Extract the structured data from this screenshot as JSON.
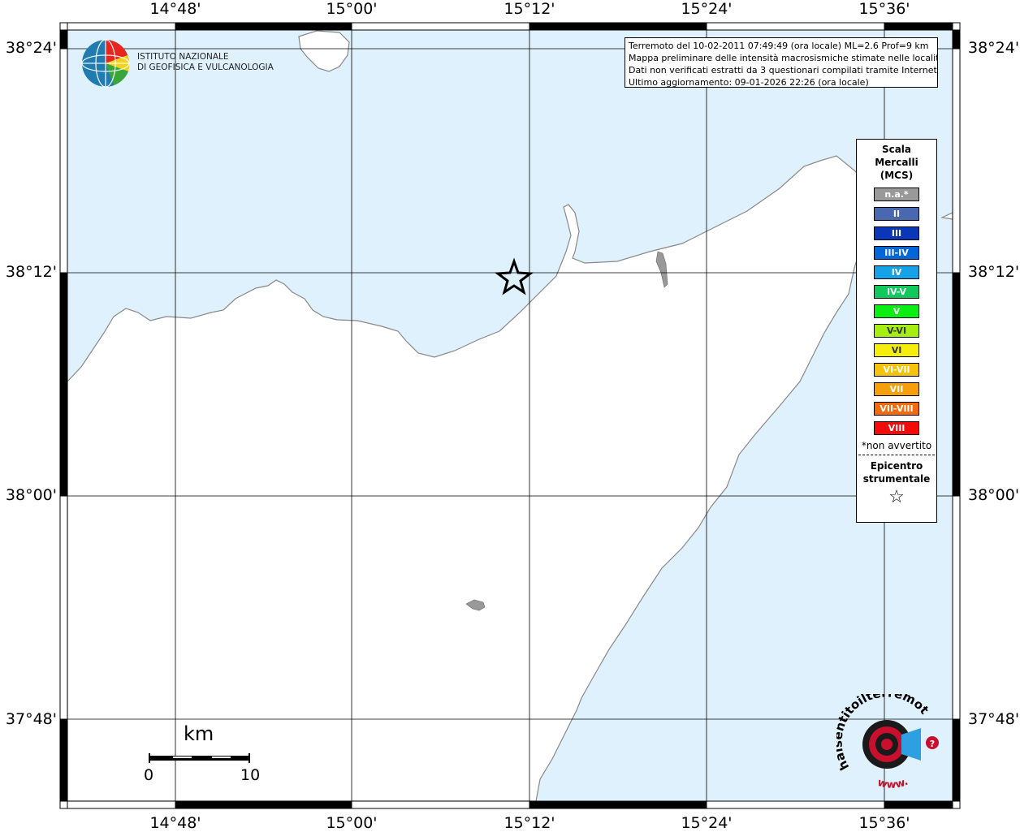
{
  "colors": {
    "sea": "#dff1fc",
    "land": "#ffffff",
    "coast": "#888888",
    "grid": "#000000",
    "frame": "#000000"
  },
  "axes": {
    "lon_labels": [
      "14°48'",
      "15°00'",
      "15°12'",
      "15°24'",
      "15°36'"
    ],
    "lat_labels": [
      "38°24'",
      "38°12'",
      "38°00'",
      "37°48'"
    ]
  },
  "info_box": {
    "line1": "Terremoto del 10-02-2011 07:49:49 (ora locale) ML=2.6 Prof=9 km",
    "line2": "Mappa preliminare delle intensità macrosismiche stimate nelle località",
    "line3": "Dati non verificati estratti da 3 questionari compilati tramite Internet.",
    "line4": "Ultimo aggiornamento: 09-01-2026 22:26 (ora locale)"
  },
  "logo": {
    "line1": "ISTITUTO NAZIONALE",
    "line2": "DI GEOFISICA E VULCANOLOGIA"
  },
  "legend": {
    "title": [
      "Scala",
      "Mercalli",
      "(MCS)"
    ],
    "items": [
      {
        "label": "n.a.*",
        "color": "#999999"
      },
      {
        "label": "II",
        "color": "#4a68b0"
      },
      {
        "label": "III",
        "color": "#0a36b8"
      },
      {
        "label": "III-IV",
        "color": "#0067d9"
      },
      {
        "label": "IV",
        "color": "#16a2e6"
      },
      {
        "label": "IV-V",
        "color": "#10c95c"
      },
      {
        "label": "V",
        "color": "#0aee14"
      },
      {
        "label": "V-VI",
        "color": "#a6ee10"
      },
      {
        "label": "VI",
        "color": "#f5ee0a"
      },
      {
        "label": "VI-VII",
        "color": "#f5c40a"
      },
      {
        "label": "VII",
        "color": "#f5a00a"
      },
      {
        "label": "VII-VIII",
        "color": "#f56a0a"
      },
      {
        "label": "VIII",
        "color": "#f50a0a"
      }
    ],
    "note": "*non avvertito",
    "epicenter_title": [
      "Epicentro",
      "strumentale"
    ],
    "star_symbol": "☆"
  },
  "scale_bar": {
    "unit": "km",
    "start": "0",
    "end": "10"
  },
  "hsn_logo": {
    "top_text": "haisentitoilterremoto.it",
    "bottom_text": "www."
  }
}
